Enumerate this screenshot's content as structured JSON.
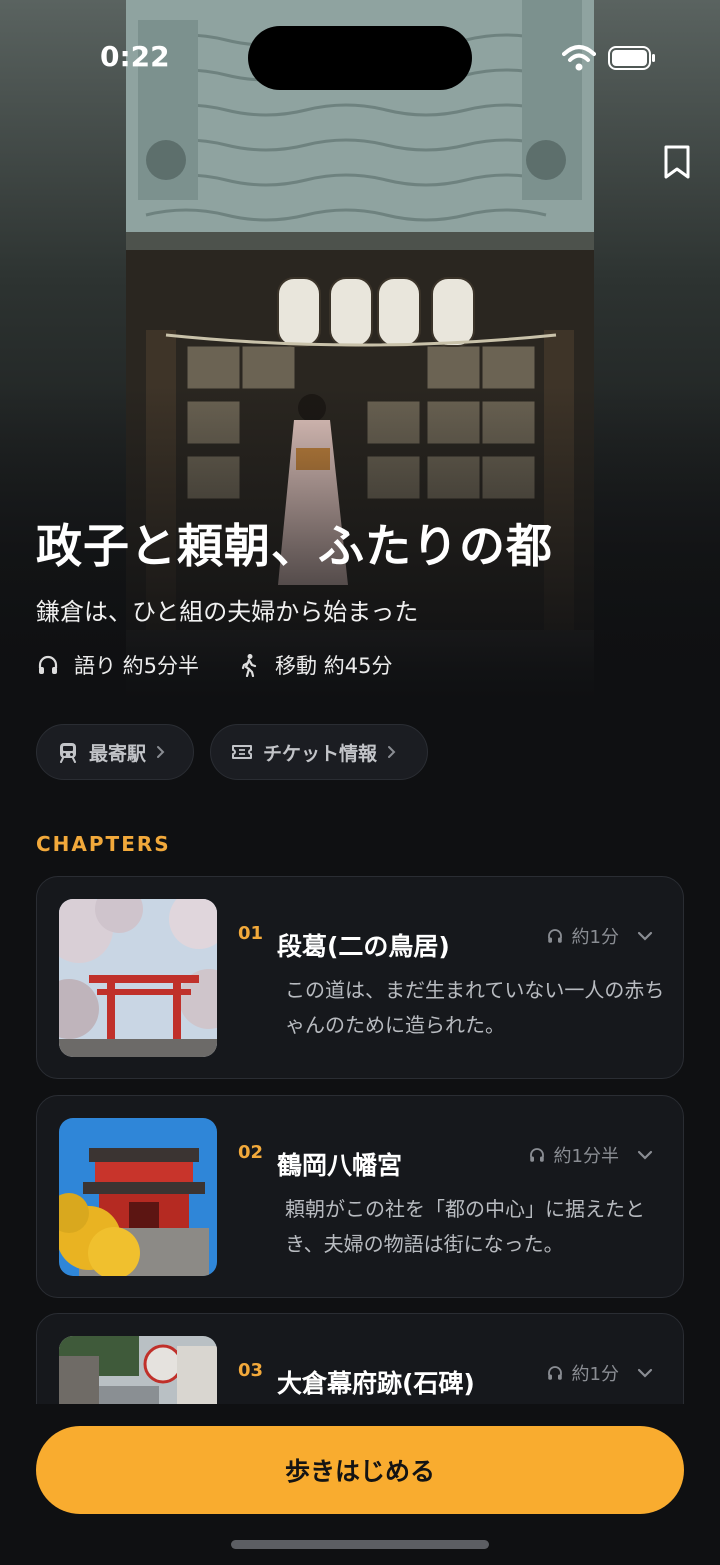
{
  "status_bar": {
    "time": "0:22",
    "icons": [
      "wifi-icon",
      "battery-icon"
    ]
  },
  "header": {
    "bookmark_icon": "bookmark-icon"
  },
  "hero": {
    "title": "政子と頼朝、ふたりの都",
    "subtitle": "鎌倉は、ひと組の夫婦から始まった",
    "narration": "語り 約5分半",
    "walking": "移動 約45分"
  },
  "quick_links": [
    {
      "label": "最寄駅",
      "icon": "train-icon"
    },
    {
      "label": "チケット情報",
      "icon": "ticket-icon"
    }
  ],
  "chapters_label": "CHAPTERS",
  "chapters": [
    {
      "number": "01",
      "title": "段葛(二の鳥居)",
      "duration": "約1分",
      "description": "この道は、まだ生まれていない一人の赤ちゃんのために造られた。"
    },
    {
      "number": "02",
      "title": "鶴岡八幡宮",
      "duration": "約1分半",
      "description": "頼朝がこの社を「都の中心」に据えたとき、夫婦の物語は街になった。"
    },
    {
      "number": "03",
      "title": "大倉幕府跡(石碑)",
      "duration": "約1分",
      "description": ""
    }
  ],
  "cta": {
    "label": "歩きはじめる"
  },
  "colors": {
    "accent": "#f9ac2f",
    "accent_text": "#f2a93b",
    "background": "#0f1012",
    "card": "#16181c"
  }
}
